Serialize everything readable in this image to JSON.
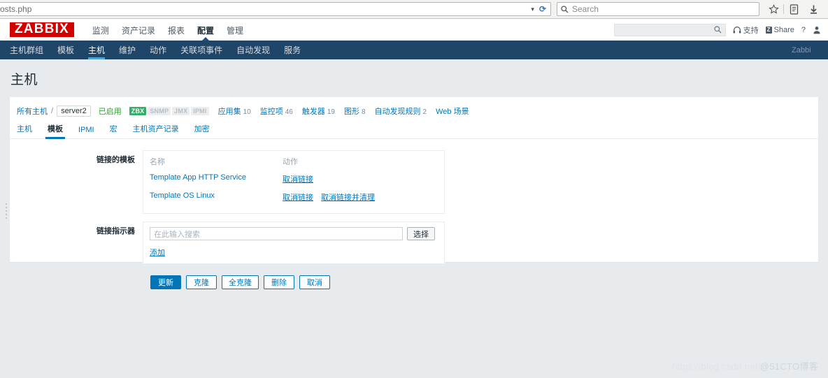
{
  "browser": {
    "url_text": "osts.php",
    "url_dropdown_icon": "chevron-down-icon",
    "reload_icon": "reload-icon",
    "search_placeholder": "Search",
    "search_icon": "search-icon",
    "toolbar_icons": [
      "star-icon",
      "reader-icon",
      "download-icon",
      "home-icon"
    ]
  },
  "zabbix_header": {
    "logo": "ZABBIX",
    "logo_bg": "#d40000",
    "menu": [
      {
        "label": "监测",
        "active": false
      },
      {
        "label": "资产记录",
        "active": false
      },
      {
        "label": "报表",
        "active": false
      },
      {
        "label": "配置",
        "active": true
      },
      {
        "label": "管理",
        "active": false
      }
    ],
    "search_value": "",
    "search_icon": "search-icon",
    "support_label": "支持",
    "support_icon": "headset-icon",
    "share_label": "Share",
    "share_badge": "Z",
    "help_label": "?",
    "user_icon": "user-icon"
  },
  "nav": {
    "items": [
      {
        "label": "主机群组",
        "active": false
      },
      {
        "label": "模板",
        "active": false
      },
      {
        "label": "主机",
        "active": true
      },
      {
        "label": "维护",
        "active": false
      },
      {
        "label": "动作",
        "active": false
      },
      {
        "label": "关联项事件",
        "active": false
      },
      {
        "label": "自动发现",
        "active": false
      },
      {
        "label": "服务",
        "active": false
      }
    ],
    "right_label": "Zabbi",
    "bg": "#1f4569",
    "active_underline": "#4ea1d3"
  },
  "page": {
    "title": "主机"
  },
  "breadcrumb": {
    "all_hosts": "所有主机",
    "separator": "/",
    "current_host": "server2",
    "status": "已启用",
    "status_color": "#25a028",
    "interfaces": [
      {
        "label": "ZBX",
        "enabled": true
      },
      {
        "label": "SNMP",
        "enabled": false
      },
      {
        "label": "JMX",
        "enabled": false
      },
      {
        "label": "IPMI",
        "enabled": false
      }
    ],
    "counts": [
      {
        "label": "应用集",
        "count": "10"
      },
      {
        "label": "监控项",
        "count": "46"
      },
      {
        "label": "触发器",
        "count": "19"
      },
      {
        "label": "图形",
        "count": "8"
      },
      {
        "label": "自动发现规则",
        "count": "2"
      },
      {
        "label": "Web 场景",
        "count": ""
      }
    ]
  },
  "tabs": [
    {
      "label": "主机",
      "active": false
    },
    {
      "label": "模板",
      "active": true
    },
    {
      "label": "IPMI",
      "active": false
    },
    {
      "label": "宏",
      "active": false
    },
    {
      "label": "主机资产记录",
      "active": false
    },
    {
      "label": "加密",
      "active": false
    }
  ],
  "form": {
    "linked_templates": {
      "label": "链接的模板",
      "col_name": "名称",
      "col_action": "动作",
      "rows": [
        {
          "name": "Template App HTTP Service",
          "actions": [
            "取消链接"
          ]
        },
        {
          "name": "Template OS Linux",
          "actions": [
            "取消链接",
            "取消链接并清理"
          ]
        }
      ]
    },
    "link_indicator": {
      "label": "链接指示器",
      "input_value": "",
      "input_placeholder": "在此输入搜索",
      "select_button": "选择",
      "add_link": "添加"
    },
    "buttons": [
      {
        "label": "更新",
        "primary": true
      },
      {
        "label": "克隆",
        "primary": false
      },
      {
        "label": "全克隆",
        "primary": false
      },
      {
        "label": "删除",
        "primary": false
      },
      {
        "label": "取消",
        "primary": false
      }
    ]
  },
  "watermark": {
    "text": "https://blog.csdn.net/",
    "overlay": "@51CTO博客"
  }
}
